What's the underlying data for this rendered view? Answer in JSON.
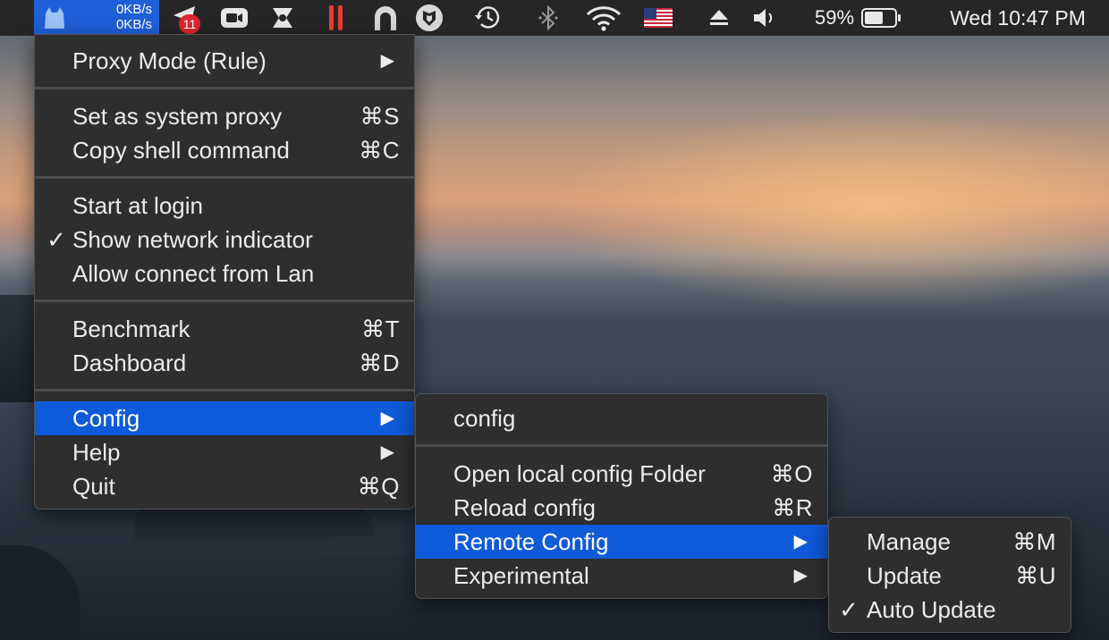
{
  "menubar": {
    "speed_up": "0KB/s",
    "speed_down": "0KB/s",
    "badge_count": "11",
    "battery_percent": "59%",
    "clock": "Wed 10:47 PM",
    "icons": [
      "clashx-cat-icon",
      "telegram-icon",
      "zoom-icon",
      "app-icon",
      "pause-icon",
      "arch-icon",
      "shield-icon",
      "time-machine-icon",
      "bluetooth-icon",
      "wifi-icon",
      "us-flag-icon",
      "eject-icon",
      "volume-icon",
      "battery-icon"
    ]
  },
  "main_menu": {
    "proxy_mode": "Proxy Mode (Rule)",
    "set_system_proxy": "Set as system proxy",
    "set_system_proxy_sc": "⌘S",
    "copy_shell": "Copy shell command",
    "copy_shell_sc": "⌘C",
    "start_login": "Start at login",
    "show_network": "Show network indicator",
    "allow_lan": "Allow connect from Lan",
    "benchmark": "Benchmark",
    "benchmark_sc": "⌘T",
    "dashboard": "Dashboard",
    "dashboard_sc": "⌘D",
    "config": "Config",
    "help": "Help",
    "quit": "Quit",
    "quit_sc": "⌘Q"
  },
  "config_menu": {
    "config": "config",
    "open_folder": "Open local config Folder",
    "open_folder_sc": "⌘O",
    "reload": "Reload config",
    "reload_sc": "⌘R",
    "remote": "Remote Config",
    "experimental": "Experimental"
  },
  "remote_menu": {
    "manage": "Manage",
    "manage_sc": "⌘M",
    "update": "Update",
    "update_sc": "⌘U",
    "auto_update": "Auto Update"
  },
  "glyphs": {
    "check": "✓",
    "arrow": "▶"
  },
  "colors": {
    "highlight": "#0f5ad9",
    "menubar": "#262626",
    "menu_bg": "#2e2e2e"
  }
}
